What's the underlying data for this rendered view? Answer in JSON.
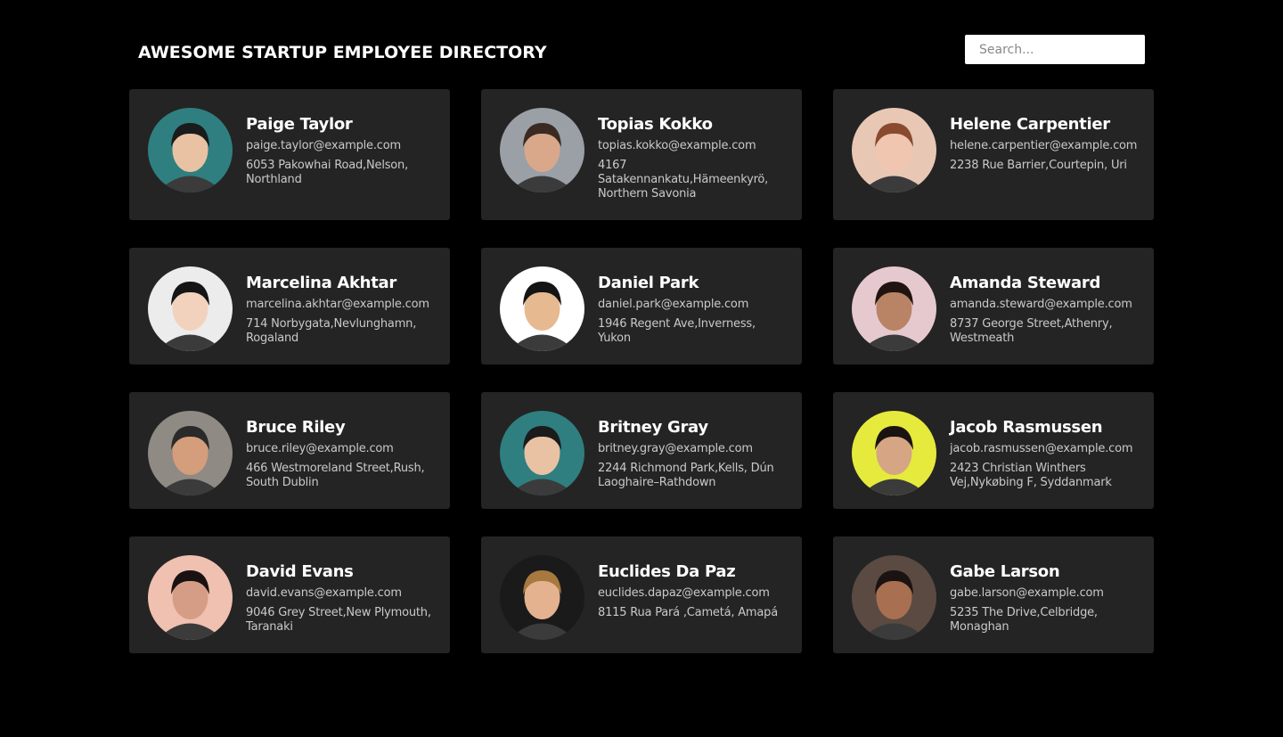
{
  "header": {
    "title": "AWESOME STARTUP EMPLOYEE DIRECTORY",
    "search_placeholder": "Search..."
  },
  "employees": [
    {
      "name": "Paige Taylor",
      "email": "paige.taylor@example.com",
      "address": "6053 Pakowhai Road,Nelson, Northland",
      "avatar_bg": "#2f7f80",
      "skin": "#e9c2a3",
      "hair": "#1b1b1b"
    },
    {
      "name": "Topias Kokko",
      "email": "topias.kokko@example.com",
      "address": "4167 Satakennankatu,Hämeenkyrö, Northern Savonia",
      "avatar_bg": "#9aa0a6",
      "skin": "#d9a88a",
      "hair": "#3a2a22"
    },
    {
      "name": "Helene Carpentier",
      "email": "helene.carpentier@example.com",
      "address": "2238 Rue Barrier,Courtepin, Uri",
      "avatar_bg": "#e8c7b5",
      "skin": "#f0c6b0",
      "hair": "#8a4a2f"
    },
    {
      "name": "Marcelina Akhtar",
      "email": "marcelina.akhtar@example.com",
      "address": "714 Norbygata,Nevlunghamn, Rogaland",
      "avatar_bg": "#ececec",
      "skin": "#f2d2bd",
      "hair": "#151515"
    },
    {
      "name": "Daniel Park",
      "email": "daniel.park@example.com",
      "address": "1946 Regent Ave,Inverness, Yukon",
      "avatar_bg": "#ffffff",
      "skin": "#e7b990",
      "hair": "#141414"
    },
    {
      "name": "Amanda Steward",
      "email": "amanda.steward@example.com",
      "address": "8737 George Street,Athenry, Westmeath",
      "avatar_bg": "#e6c9cf",
      "skin": "#b98366",
      "hair": "#1f1410"
    },
    {
      "name": "Bruce Riley",
      "email": "bruce.riley@example.com",
      "address": "466 Westmoreland Street,Rush, South Dublin",
      "avatar_bg": "#8f8a83",
      "skin": "#d49d7b",
      "hair": "#2a2a2a"
    },
    {
      "name": "Britney Gray",
      "email": "britney.gray@example.com",
      "address": "2244 Richmond Park,Kells, Dún Laoghaire–Rathdown",
      "avatar_bg": "#2f7f80",
      "skin": "#e9c2a3",
      "hair": "#1b1b1b"
    },
    {
      "name": "Jacob Rasmussen",
      "email": "jacob.rasmussen@example.com",
      "address": "2423 Christian Winthers Vej,Nykøbing F, Syddanmark",
      "avatar_bg": "#e6ea3c",
      "skin": "#d5a584",
      "hair": "#1a1410"
    },
    {
      "name": "David Evans",
      "email": "david.evans@example.com",
      "address": "9046 Grey Street,New Plymouth, Taranaki",
      "avatar_bg": "#f0c0b0",
      "skin": "#d69d86",
      "hair": "#1a1212"
    },
    {
      "name": "Euclides Da Paz",
      "email": "euclides.dapaz@example.com",
      "address": "8115 Rua Pará ,Cametá, Amapá",
      "avatar_bg": "#1a1a1a",
      "skin": "#e4b28f",
      "hair": "#a7783f"
    },
    {
      "name": "Gabe Larson",
      "email": "gabe.larson@example.com",
      "address": "5235 The Drive,Celbridge, Monaghan",
      "avatar_bg": "#5a4a42",
      "skin": "#a86f50",
      "hair": "#1b1311"
    }
  ]
}
